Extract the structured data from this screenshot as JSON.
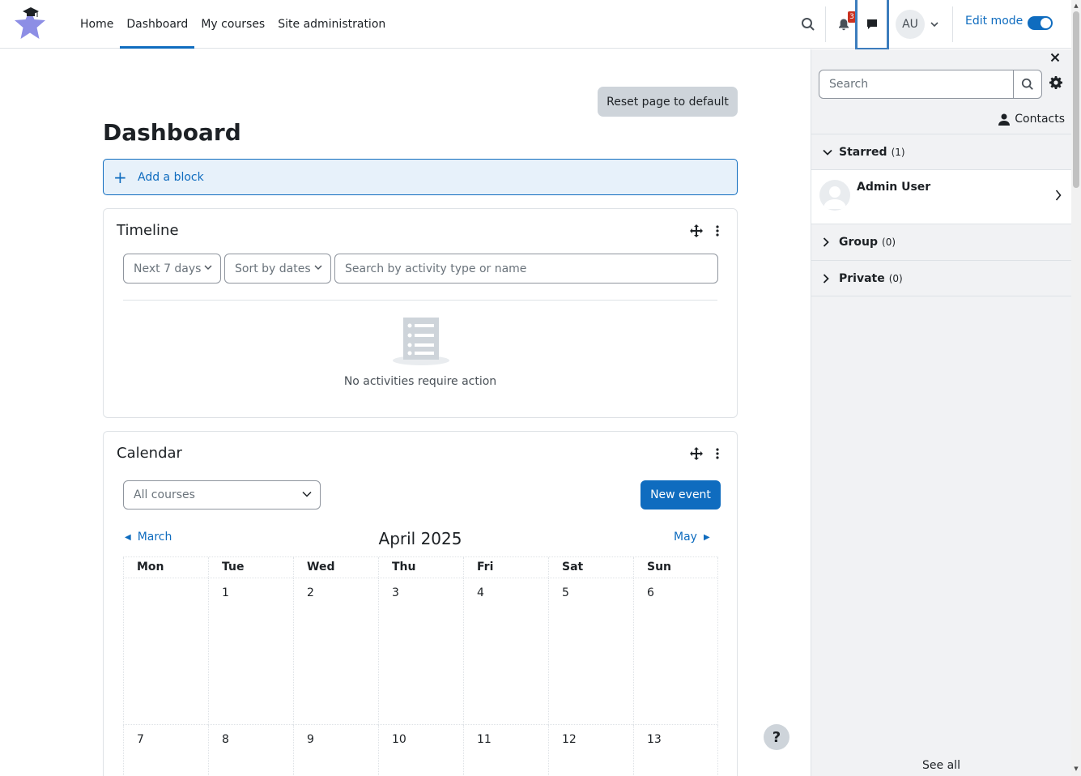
{
  "nav": {
    "links": [
      "Home",
      "Dashboard",
      "My courses",
      "Site administration"
    ],
    "active_index": 1,
    "notification_count": "3",
    "user_initials": "AU",
    "edit_mode_label": "Edit mode",
    "edit_mode_on": true
  },
  "main": {
    "reset_label": "Reset page to default",
    "title": "Dashboard",
    "add_block_label": "Add a block"
  },
  "timeline": {
    "title": "Timeline",
    "filter_label": "Next 7 days",
    "sort_label": "Sort by dates",
    "search_placeholder": "Search by activity type or name",
    "empty_text": "No activities require action"
  },
  "calendar": {
    "title": "Calendar",
    "course_filter": "All courses",
    "new_event_label": "New event",
    "prev_month": "March",
    "month_title": "April 2025",
    "next_month": "May",
    "weekdays": [
      "Mon",
      "Tue",
      "Wed",
      "Thu",
      "Fri",
      "Sat",
      "Sun"
    ],
    "weeks": [
      [
        "",
        "1",
        "2",
        "3",
        "4",
        "5",
        "6"
      ],
      [
        "7",
        "8",
        "9",
        "10",
        "11",
        "12",
        "13"
      ]
    ]
  },
  "drawer": {
    "search_placeholder": "Search",
    "contacts_label": "Contacts",
    "starred_label": "Starred",
    "starred_count": "(1)",
    "contact_name": "Admin User",
    "group_label": "Group",
    "group_count": "(0)",
    "private_label": "Private",
    "private_count": "(0)",
    "see_all_label": "See all"
  },
  "help_label": "?",
  "colors": {
    "primary": "#0f6cbf",
    "focus_outline": "#3c7dbd",
    "badge": "#ca3120",
    "logo_star": "#8d8ee5"
  }
}
